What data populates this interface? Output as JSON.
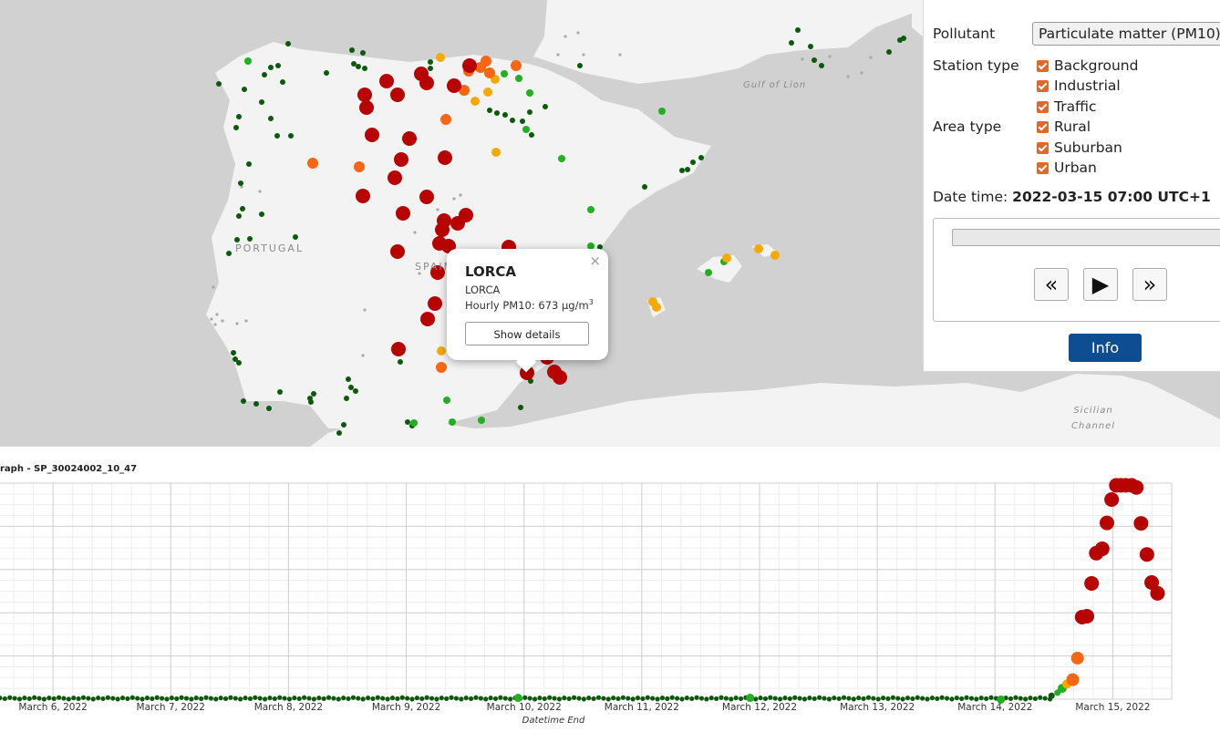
{
  "map": {
    "labels": {
      "portugal": "PORTUGAL",
      "spain": "SPAIN",
      "gulf": "Gulf of Lion",
      "sicilian_line1": "Sicilian",
      "sicilian_line2": "Channel"
    },
    "colors": {
      "sea": "#d1d1d1",
      "land": "#f3f3f3",
      "good": "#0b5a0b",
      "fair": "#22b022",
      "moderate": "#f5a905",
      "poor": "#f76612",
      "very_poor": "#b80303"
    }
  },
  "panel": {
    "pollutant_label": "Pollutant",
    "pollutant_value": "Particulate matter (PM10)",
    "station_type_label": "Station type",
    "station_types": [
      {
        "label": "Background",
        "checked": true
      },
      {
        "label": "Industrial",
        "checked": true
      },
      {
        "label": "Traffic",
        "checked": true
      }
    ],
    "area_type_label": "Area type",
    "area_types": [
      {
        "label": "Rural",
        "checked": true
      },
      {
        "label": "Suburban",
        "checked": true
      },
      {
        "label": "Urban",
        "checked": true
      }
    ],
    "datetime_label": "Date time:",
    "datetime_value": "2022-03-15 07:00 UTC+1",
    "prev_label": "«",
    "play_label": "▶",
    "next_label": "»",
    "info_label": "Info",
    "accent_color": "#e4672a",
    "info_color": "#0e4d92"
  },
  "popup": {
    "title": "LORCA",
    "subtitle": "LORCA",
    "value_text": "Hourly PM10: 673 μg/m",
    "value_unit_sup": "3",
    "close_label": "×",
    "details_label": "Show details"
  },
  "graph": {
    "title": "raph - SP_30024002_10_47",
    "chart_data": {
      "type": "scatter",
      "xlabel": "Datetime End",
      "ylabel": "",
      "x_tick_labels": [
        "March 6, 2022",
        "March 7, 2022",
        "March 8, 2022",
        "March 9, 2022",
        "March 10, 2022",
        "March 11, 2022",
        "March 12, 2022",
        "March 13, 2022",
        "March 14, 2022",
        "March 15, 2022"
      ],
      "x_tick_days": [
        6,
        7,
        8,
        9,
        10,
        11,
        12,
        13,
        14,
        15
      ],
      "xlim": [
        5.55,
        15.5
      ],
      "ylim": [
        0,
        500
      ],
      "grid": true,
      "low_series_day_start": 5.55,
      "low_series_day_end": 14.47,
      "low_series_value": 2,
      "low_highlights": [
        {
          "day": 9.95,
          "value": 20
        },
        {
          "day": 11.92,
          "value": 20
        },
        {
          "day": 14.05,
          "value": 16
        }
      ],
      "rise_points": [
        {
          "day": 14.48,
          "value": 8
        },
        {
          "day": 14.53,
          "value": 15
        },
        {
          "day": 14.57,
          "value": 25
        },
        {
          "day": 14.61,
          "value": 35
        },
        {
          "day": 14.66,
          "value": 45
        },
        {
          "day": 14.7,
          "value": 95
        },
        {
          "day": 14.74,
          "value": 190
        },
        {
          "day": 14.78,
          "value": 192
        },
        {
          "day": 14.82,
          "value": 268
        },
        {
          "day": 14.86,
          "value": 338
        },
        {
          "day": 14.91,
          "value": 348
        },
        {
          "day": 14.95,
          "value": 408
        },
        {
          "day": 14.99,
          "value": 462
        },
        {
          "day": 15.03,
          "value": 495
        },
        {
          "day": 15.07,
          "value": 495
        },
        {
          "day": 15.11,
          "value": 495
        },
        {
          "day": 15.16,
          "value": 495
        },
        {
          "day": 15.2,
          "value": 490
        },
        {
          "day": 15.24,
          "value": 407
        },
        {
          "day": 15.29,
          "value": 335
        },
        {
          "day": 15.33,
          "value": 270
        },
        {
          "day": 15.38,
          "value": 245
        }
      ]
    }
  }
}
